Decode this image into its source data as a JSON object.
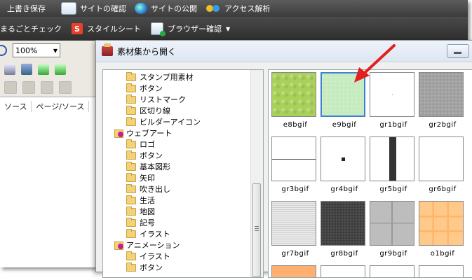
{
  "toolbar_top": {
    "items": [
      {
        "label": "上書き保存",
        "icon": "save-icon"
      },
      {
        "label": "サイトの確認",
        "icon": "page-icon"
      },
      {
        "label": "サイトの公開",
        "icon": "globe-icon"
      },
      {
        "label": "アクセス解析",
        "icon": "analytics-icon"
      }
    ]
  },
  "toolbar_second": {
    "items": [
      {
        "label": "まるごとチェック"
      },
      {
        "label": "スタイルシート",
        "icon_letter": "S"
      },
      {
        "label": "ブラウザー確認",
        "has_dropdown": true
      }
    ]
  },
  "editor": {
    "zoom_value": "100%",
    "tabs": [
      "ソース",
      "ページ/ソース"
    ]
  },
  "dialog": {
    "title": "素材集から開く",
    "tree": [
      {
        "label": "スタンプ用素材",
        "type": "folder",
        "level": 1
      },
      {
        "label": "ボタン",
        "type": "folder",
        "level": 1
      },
      {
        "label": "リストマーク",
        "type": "folder",
        "level": 1
      },
      {
        "label": "区切り線",
        "type": "folder",
        "level": 1
      },
      {
        "label": "ビルダーアイコン",
        "type": "folder",
        "level": 1
      },
      {
        "label": "ウェブアート",
        "type": "group",
        "level": 0
      },
      {
        "label": "ロゴ",
        "type": "folder",
        "level": 1
      },
      {
        "label": "ボタン",
        "type": "folder",
        "level": 1
      },
      {
        "label": "基本図形",
        "type": "folder",
        "level": 1
      },
      {
        "label": "矢印",
        "type": "folder",
        "level": 1
      },
      {
        "label": "吹き出し",
        "type": "folder",
        "level": 1
      },
      {
        "label": "生活",
        "type": "folder",
        "level": 1
      },
      {
        "label": "地図",
        "type": "folder",
        "level": 1
      },
      {
        "label": "記号",
        "type": "folder",
        "level": 1
      },
      {
        "label": "イラスト",
        "type": "folder",
        "level": 1
      },
      {
        "label": "アニメーション",
        "type": "group",
        "level": 0
      },
      {
        "label": "イラスト",
        "type": "folder",
        "level": 1
      },
      {
        "label": "ボタン",
        "type": "folder",
        "level": 1
      }
    ],
    "thumbnails": [
      {
        "label": "e8bgif",
        "style": "bg-green"
      },
      {
        "label": "e9bgif",
        "style": "bg-mint",
        "selected": true
      },
      {
        "label": "gr1bgif",
        "style": "bg-tinydot"
      },
      {
        "label": "gr2bgif",
        "style": "bg-gray"
      },
      {
        "label": "gr3bgif",
        "style": "bg-hline"
      },
      {
        "label": "gr4bgif",
        "style": "bg-dot"
      },
      {
        "label": "gr5bgif",
        "style": "bg-vbar"
      },
      {
        "label": "gr6bgif",
        "style": "plain"
      },
      {
        "label": "gr7bgif",
        "style": "bg-lightgray"
      },
      {
        "label": "gr8bgif",
        "style": "bg-dark"
      },
      {
        "label": "gr9bgif",
        "style": "bg-stone"
      },
      {
        "label": "o1bgif",
        "style": "bg-orange"
      }
    ]
  },
  "colors": {
    "toolbar_dark": "#3c3c3c",
    "selection_border": "#3f7fd6",
    "arrow": "#e32020"
  }
}
